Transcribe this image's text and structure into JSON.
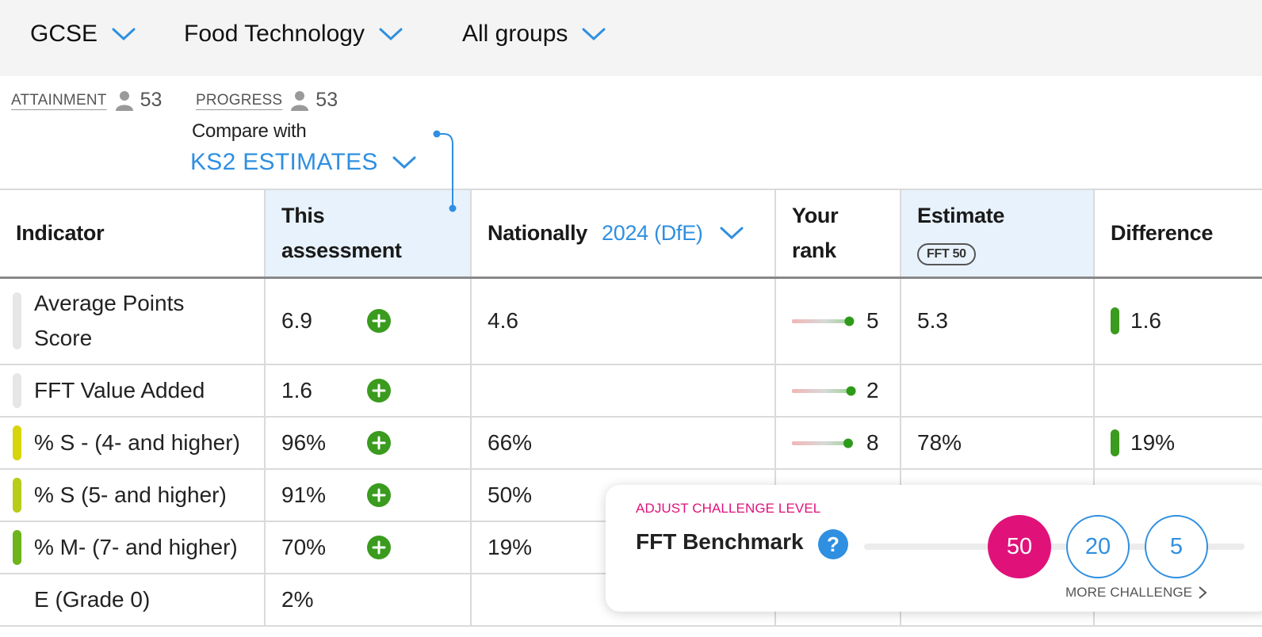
{
  "filters": {
    "level": "GCSE",
    "subject": "Food Technology",
    "group": "All groups"
  },
  "stats": {
    "attainment_label": "ATTAINMENT",
    "attainment_count": "53",
    "progress_label": "PROGRESS",
    "progress_count": "53"
  },
  "compare": {
    "label": "Compare with",
    "value": "KS2 ESTIMATES"
  },
  "table": {
    "headers": {
      "indicator": "Indicator",
      "this_assessment_1": "This",
      "this_assessment_2": "assessment",
      "nationally": "Nationally",
      "nationally_year": "2024 (DfE)",
      "rank_1": "Your",
      "rank_2": "rank",
      "estimate": "Estimate",
      "estimate_pill": "FFT 50",
      "difference": "Difference"
    },
    "rows": [
      {
        "indicator": "Average Points Score",
        "bar_color": "#e6e6e6",
        "this": "6.9",
        "plus": true,
        "national": "4.6",
        "rank": "5",
        "rank_fill": 0.95,
        "estimate": "5.3",
        "difference": "1.6",
        "diff_bar": true
      },
      {
        "indicator": "FFT Value Added",
        "bar_color": "#e6e6e6",
        "this": "1.6",
        "plus": true,
        "national": "",
        "rank": "2",
        "rank_fill": 0.98,
        "estimate": "",
        "difference": "",
        "diff_bar": false
      },
      {
        "indicator": "% S - (4- and higher)",
        "bar_color": "#d8d40a",
        "this": "96%",
        "plus": true,
        "national": "66%",
        "rank": "8",
        "rank_fill": 0.93,
        "estimate": "78%",
        "difference": "19%",
        "diff_bar": true
      },
      {
        "indicator": "% S (5- and higher)",
        "bar_color": "#b8cc1a",
        "this": "91%",
        "plus": true,
        "national": "50%",
        "rank": "",
        "rank_fill": null,
        "estimate": "",
        "difference": "",
        "diff_bar": false
      },
      {
        "indicator": "% M- (7- and higher)",
        "bar_color": "#6cb41a",
        "this": "70%",
        "plus": true,
        "national": "19%",
        "rank": "",
        "rank_fill": null,
        "estimate": "",
        "difference": "",
        "diff_bar": false
      },
      {
        "indicator": "E (Grade 0)",
        "bar_color": "",
        "this": "2%",
        "plus": false,
        "national": "",
        "rank": "",
        "rank_fill": null,
        "estimate": "",
        "difference": "",
        "diff_bar": false
      }
    ]
  },
  "popup": {
    "title": "ADJUST CHALLENGE LEVEL",
    "name": "FFT Benchmark",
    "help": "?",
    "options": [
      "50",
      "20",
      "5"
    ],
    "selected": "50",
    "more_label": "MORE CHALLENGE"
  },
  "colors": {
    "accent_blue": "#2f8fe0",
    "accent_pink": "#e0127a",
    "positive_green": "#3a9b1e"
  }
}
